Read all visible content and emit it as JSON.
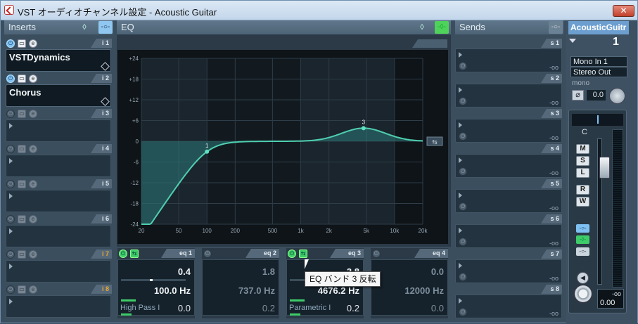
{
  "window": {
    "title": "VST オーディオチャンネル設定 - Acoustic Guitar",
    "close": "✕"
  },
  "inserts": {
    "header": "Inserts",
    "slots": [
      {
        "tab": "i 1",
        "name": "VSTDynamics",
        "active": true
      },
      {
        "tab": "i 2",
        "name": "Chorus",
        "active": true
      },
      {
        "tab": "i 3",
        "name": "",
        "active": false
      },
      {
        "tab": "i 4",
        "name": "",
        "active": false
      },
      {
        "tab": "i 5",
        "name": "",
        "active": false
      },
      {
        "tab": "i 6",
        "name": "",
        "active": false
      },
      {
        "tab": "i 7",
        "name": "",
        "active": false
      },
      {
        "tab": "i 8",
        "name": "",
        "active": false
      }
    ]
  },
  "eq": {
    "header": "EQ",
    "y_ticks": [
      "+24",
      "+18",
      "+12",
      "+6",
      "0",
      "-6",
      "-12",
      "-18",
      "-24"
    ],
    "x_ticks": [
      "20",
      "50",
      "100",
      "200",
      "500",
      "1k",
      "2k",
      "5k",
      "10k",
      "20k"
    ],
    "points": [
      {
        "label": "1"
      },
      {
        "label": "3"
      }
    ],
    "bands": [
      {
        "tab": "eq 1",
        "gain": "0.4",
        "freq": "100.0 Hz",
        "q": "0.0",
        "type": "High Pass I",
        "gain_fill": 0.45,
        "q_fill": 0.08,
        "active": true
      },
      {
        "tab": "eq 2",
        "gain": "1.8",
        "freq": "737.0 Hz",
        "q": "0.2",
        "type": "",
        "gain_fill": 0.0,
        "q_fill": 0.0,
        "active": false
      },
      {
        "tab": "eq 3",
        "gain": "3.8",
        "freq": "4676.2 Hz",
        "q": "0.2",
        "type": "Parametric I",
        "gain_fill": 0.58,
        "q_fill": 0.08,
        "active": true
      },
      {
        "tab": "eq 4",
        "gain": "0.0",
        "freq": "12000 Hz",
        "q": "0.0",
        "type": "",
        "gain_fill": 0.0,
        "q_fill": 0.0,
        "active": false
      }
    ],
    "tooltip": "EQ バンド 3 反転"
  },
  "sends": {
    "header": "Sends",
    "slots": [
      {
        "tab": "s 1",
        "level": "-oo"
      },
      {
        "tab": "s 2",
        "level": "-oo"
      },
      {
        "tab": "s 3",
        "level": "-oo"
      },
      {
        "tab": "s 4",
        "level": "-oo"
      },
      {
        "tab": "s 5",
        "level": "-oo"
      },
      {
        "tab": "s 6",
        "level": "-oo"
      },
      {
        "tab": "s 7",
        "level": "-oo"
      },
      {
        "tab": "s 8",
        "level": "-oo"
      }
    ]
  },
  "channel": {
    "name": "AcousticGuitr",
    "number": "1",
    "input": "Mono In 1",
    "output": "Stereo Out",
    "mode": "mono",
    "gain": "0.0",
    "pan": "C",
    "buttons": [
      "M",
      "S",
      "L",
      "R",
      "W"
    ],
    "fader_value": "0.00",
    "meter_peak": "-oo"
  },
  "colors": {
    "accent_blue": "#7ec0f2",
    "accent_green": "#3ecc6a",
    "curve": "#4fd0b0",
    "orange_tab": "#f0a830"
  }
}
